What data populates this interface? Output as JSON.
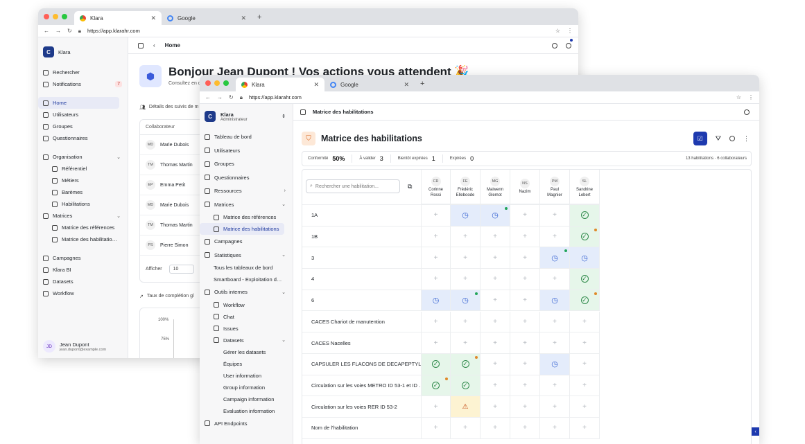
{
  "back_window": {
    "tabs": [
      {
        "label": "Klara"
      },
      {
        "label": "Google"
      }
    ],
    "url": "https://app.klarahr.com",
    "app_name": "Klara",
    "sidebar": [
      {
        "label": "Rechercher",
        "icon": "search-icon"
      },
      {
        "label": "Notifications",
        "icon": "bell-icon",
        "badge": "7"
      },
      {
        "label": "Home",
        "icon": "home-icon",
        "selected": true
      },
      {
        "label": "Utilisateurs",
        "icon": "user-icon"
      },
      {
        "label": "Groupes",
        "icon": "users-icon"
      },
      {
        "label": "Questionnaires",
        "icon": "list-icon"
      },
      {
        "label": "Organisation",
        "icon": "building-icon",
        "expanded": true
      },
      {
        "label": "Référentiel",
        "icon": "book-icon",
        "sub": true
      },
      {
        "label": "Métiers",
        "icon": "book-icon",
        "sub": true
      },
      {
        "label": "Barèmes",
        "icon": "scale-icon",
        "sub": true
      },
      {
        "label": "Habilitations",
        "icon": "shield-icon",
        "sub": true
      },
      {
        "label": "Matrices",
        "icon": "grid-icon",
        "expanded": true
      },
      {
        "label": "Matrice des références",
        "icon": "table-icon",
        "sub": true
      },
      {
        "label": "Matrice des habilitatio…",
        "icon": "shield-icon",
        "sub": true
      },
      {
        "label": "Campagnes",
        "icon": "megaphone-icon"
      },
      {
        "label": "Klara BI",
        "icon": "users-icon"
      },
      {
        "label": "Datasets",
        "icon": "database-icon"
      },
      {
        "label": "Workflow",
        "icon": "workflow-icon"
      }
    ],
    "user": {
      "initials": "JD",
      "name": "Jean Dupont",
      "email": "jean.dupont@example.com"
    },
    "header_title": "Home",
    "greeting": "Bonjour Jean Dupont ! Vos actions vous attendent 🎉",
    "greeting_sub": "Consultez en d",
    "details_label": "Détails des suivis de m",
    "col_header": "Collaborateur",
    "collaborators": [
      {
        "initials": "MD",
        "name": "Marie Dubois"
      },
      {
        "initials": "TM",
        "name": "Thomas Martin"
      },
      {
        "initials": "EP",
        "name": "Emma Petit"
      },
      {
        "initials": "MD",
        "name": "Marie Dubois"
      },
      {
        "initials": "TM",
        "name": "Thomas Martin"
      },
      {
        "initials": "PS",
        "name": "Pierre Simon"
      }
    ],
    "afficher_label": "Afficher",
    "afficher_value": "10",
    "taux_label": "Taux de complétion gl",
    "chart_ticks": [
      "100%",
      "75%"
    ]
  },
  "front_window": {
    "tabs": [
      {
        "label": "Klara"
      },
      {
        "label": "Google"
      }
    ],
    "url": "https://app.klarahr.com",
    "org": {
      "name": "Klara",
      "role": "Administrateur"
    },
    "sidebar": [
      {
        "label": "Tableau de bord",
        "level": 0,
        "icon": "home-icon"
      },
      {
        "label": "Utilisateurs",
        "level": 0,
        "icon": "user-icon"
      },
      {
        "label": "Groupes",
        "level": 0,
        "icon": "users-icon"
      },
      {
        "label": "Questionnaires",
        "level": 0,
        "icon": "list-icon"
      },
      {
        "label": "Ressources",
        "level": 0,
        "icon": "book-icon",
        "chevron": "›"
      },
      {
        "label": "Matrices",
        "level": 0,
        "icon": "grid-icon",
        "chevron": "⌄"
      },
      {
        "label": "Matrice des références",
        "level": 1,
        "icon": "table-icon"
      },
      {
        "label": "Matrice des habilitations",
        "level": 1,
        "icon": "shield-icon",
        "selected": true
      },
      {
        "label": "Campagnes",
        "level": 0,
        "icon": "megaphone-icon"
      },
      {
        "label": "Statistiques",
        "level": 0,
        "icon": "chart-icon",
        "chevron": "⌄"
      },
      {
        "label": "Tous les tableaux de bord",
        "level": 0.5,
        "icon": ""
      },
      {
        "label": "Smartboard - Exploitation d…",
        "level": 0.5,
        "icon": ""
      },
      {
        "label": "Outils internes",
        "level": 0,
        "icon": "wrench-icon",
        "chevron": "⌄"
      },
      {
        "label": "Workflow",
        "level": 1,
        "icon": "workflow-icon"
      },
      {
        "label": "Chat",
        "level": 1,
        "icon": "chat-icon"
      },
      {
        "label": "Issues",
        "level": 1,
        "icon": "issue-icon"
      },
      {
        "label": "Datasets",
        "level": 1,
        "icon": "database-icon",
        "chevron": "⌄"
      },
      {
        "label": "Gérer les datasets",
        "level": 2,
        "icon": ""
      },
      {
        "label": "Équipes",
        "level": 2,
        "icon": ""
      },
      {
        "label": "User information",
        "level": 2,
        "icon": ""
      },
      {
        "label": "Group information",
        "level": 2,
        "icon": ""
      },
      {
        "label": "Campaign information",
        "level": 2,
        "icon": ""
      },
      {
        "label": "Evaluation information",
        "level": 2,
        "icon": ""
      },
      {
        "label": "API Endpoints",
        "level": 0,
        "icon": "gear-icon"
      }
    ],
    "header_title": "Matrice des habilitations",
    "page_title": "Matrice des habilitations",
    "stats": {
      "conformite_label": "Conformité",
      "conformite_value": "50%",
      "a_valider_label": "À valider",
      "a_valider_value": "3",
      "bientot_label": "Bientôt expirées",
      "bientot_value": "1",
      "expirees_label": "Expirées",
      "expirees_value": "0",
      "summary": "13 habilitations · 6 collaborateurs"
    },
    "search_placeholder": "Rechercher une habilitation...",
    "people": [
      {
        "initials": "CR",
        "first": "Corinne",
        "last": "Rossi"
      },
      {
        "initials": "FE",
        "first": "Frédéric",
        "last": "Elleboode"
      },
      {
        "initials": "MG",
        "first": "Maiwenn",
        "last": "Glemot"
      },
      {
        "initials": "NS",
        "first": "Nazim",
        "last": ""
      },
      {
        "initials": "PM",
        "first": "Paul",
        "last": "Magnier"
      },
      {
        "initials": "SL",
        "first": "Sandrine",
        "last": "Lebert"
      }
    ],
    "rows": [
      {
        "label": "1A",
        "cells": [
          "plus",
          "clock",
          "clock|g",
          "plus",
          "plus",
          "check"
        ]
      },
      {
        "label": "1B",
        "cells": [
          "plus",
          "plus",
          "plus",
          "plus",
          "plus",
          "check|o"
        ]
      },
      {
        "label": "3",
        "cells": [
          "plus",
          "plus",
          "plus",
          "plus",
          "clock|g",
          "clock"
        ]
      },
      {
        "label": "4",
        "cells": [
          "plus",
          "plus",
          "plus",
          "plus",
          "plus",
          "check"
        ]
      },
      {
        "label": "6",
        "cells": [
          "clock",
          "clock|g",
          "plus",
          "plus",
          "clock",
          "check|o"
        ]
      },
      {
        "label": "CACES Chariot de manutention",
        "cells": [
          "plus",
          "plus",
          "plus",
          "plus",
          "plus",
          "plus"
        ]
      },
      {
        "label": "CACES Nacelles",
        "cells": [
          "plus",
          "plus",
          "plus",
          "plus",
          "plus",
          "plus"
        ]
      },
      {
        "label": "CAPSULER LES FLACONS DE DECAPEPTYL …",
        "cells": [
          "check",
          "check|o",
          "plus",
          "plus",
          "clock",
          "plus"
        ]
      },
      {
        "label": "Circulation sur les voies METRO ID 53-1 et ID …",
        "cells": [
          "check|o",
          "check",
          "plus",
          "plus",
          "plus",
          "plus"
        ]
      },
      {
        "label": "Circulation sur les voies RER ID 53-2",
        "cells": [
          "plus",
          "warn",
          "plus",
          "plus",
          "plus",
          "plus"
        ]
      },
      {
        "label": "Nom de l'habilitation",
        "cells": [
          "plus",
          "plus",
          "plus",
          "plus",
          "plus",
          "plus"
        ]
      }
    ],
    "colors": {
      "accent": "#1e3aaf",
      "green_bg": "#e6f6ea",
      "blue_bg": "#e4ecfb",
      "yellow_bg": "#fdf3d2",
      "green": "#2f8a4a",
      "blue": "#2d5bd0",
      "orange": "#e0892a"
    }
  }
}
